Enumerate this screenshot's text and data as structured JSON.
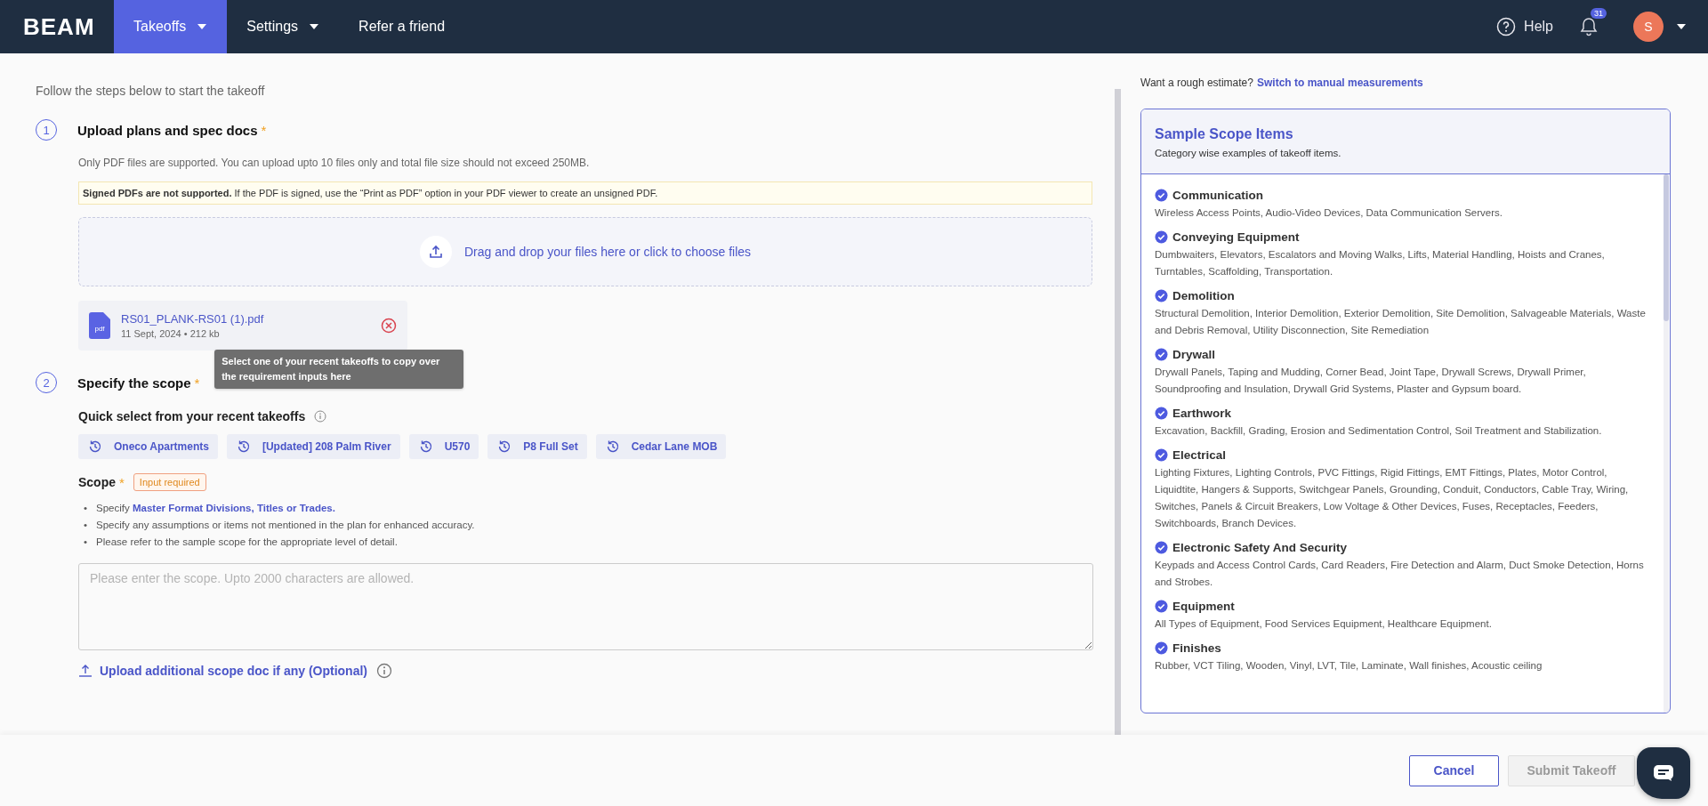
{
  "nav": {
    "logo": "BEAM",
    "items": [
      {
        "label": "Takeoffs",
        "selected": true,
        "dropdown": true
      },
      {
        "label": "Settings",
        "selected": false,
        "dropdown": true
      },
      {
        "label": "Refer a friend",
        "selected": false,
        "dropdown": false
      }
    ],
    "help": "Help",
    "notifications": "31",
    "avatar": "S"
  },
  "intro": "Follow the steps below to start the takeoff",
  "upload": {
    "number": "1",
    "title": "Upload plans and spec docs",
    "required_mark": "*",
    "note": "Only PDF files are supported. You can upload upto 10 files only and total file size should not exceed 250MB.",
    "warning": "**Signed PDFs are not supported.** If the PDF is signed, use the “Print as PDF” option in your PDF viewer to create an unsigned PDF.",
    "dropzone": "Drag and drop your files here or click to choose files",
    "files": [
      {
        "type": "pdf",
        "name": "RS01_PLANK-RS01 (1).pdf",
        "meta": "11 Sept, 2024 • 212 kb"
      }
    ]
  },
  "scope": {
    "number": "2",
    "title": "Specify the scope",
    "quick_select": "Quick select from your recent takeoffs",
    "tooltip": "Select one of your recent takeoffs to copy over the requirement inputs here",
    "recent": [
      "Oneco Apartments",
      "[Updated] 208 Palm River",
      "U570",
      "P8 Full Set",
      "Cedar Lane MOB"
    ],
    "label": "Scope",
    "required_mark": "*",
    "badge": "Input required",
    "bullets": [
      {
        "marker": "•",
        "text": "Specify ",
        "link": "Master Format Divisions, Titles or Trades."
      },
      {
        "marker": "•",
        "text": "Specify any assumptions or items not mentioned in the plan for enhanced accuracy."
      },
      {
        "marker": "•",
        "text": "Please refer to the sample scope for the appropriate level of detail."
      }
    ],
    "placeholder": "Please enter the scope. Upto 2000 characters are allowed.",
    "upload_link": "Upload additional scope doc if any (Optional)"
  },
  "estimate": {
    "prompt": "Want a rough estimate?",
    "link": "Switch to manual measurements"
  },
  "sample": {
    "title": "Sample Scope Items",
    "subtitle": "Category wise examples of takeoff items.",
    "items": [
      {
        "title": "Communication",
        "text": "Wireless Access Points, Audio-Video Devices, Data Communication Servers."
      },
      {
        "title": "Conveying Equipment",
        "text": "Dumbwaiters, Elevators, Escalators and Moving Walks, Lifts, Material Handling, Hoists and Cranes, Turntables, Scaffolding, Transportation."
      },
      {
        "title": "Demolition",
        "text": "Structural Demolition, Interior Demolition, Exterior Demolition, Site Demolition, Salvageable Materials, Waste and Debris Removal, Utility Disconnection, Site Remediation"
      },
      {
        "title": "Drywall",
        "text": "Drywall Panels, Taping and Mudding, Corner Bead, Joint Tape, Drywall Screws, Drywall Primer, Soundproofing and Insulation, Drywall Grid Systems, Plaster and Gypsum board."
      },
      {
        "title": "Earthwork",
        "text": "Excavation, Backfill, Grading, Erosion and Sedimentation Control, Soil Treatment and Stabilization."
      },
      {
        "title": "Electrical",
        "text": "Lighting Fixtures, Lighting Controls, PVC Fittings, Rigid Fittings, EMT Fittings, Plates, Motor Control, Liquidtite, Hangers & Supports, Switchgear Panels, Grounding, Conduit, Conductors, Cable Tray, Wiring, Switches, Panels & Circuit Breakers, Low Voltage & Other Devices, Fuses, Receptacles, Feeders, Switchboards, Branch Devices."
      },
      {
        "title": "Electronic Safety And Security",
        "text": "Keypads and Access Control Cards, Card Readers, Fire Detection and Alarm, Duct Smoke Detection, Horns and Strobes."
      },
      {
        "title": "Equipment",
        "text": "All Types of Equipment, Food Services Equipment, Healthcare Equipment."
      },
      {
        "title": "Finishes",
        "text": "Rubber, VCT Tiling, Wooden, Vinyl, LVT, Tile, Laminate, Wall finishes, Acoustic ceiling"
      }
    ]
  },
  "footer": {
    "cancel": "Cancel",
    "submit": {
      "label": "Submit Takeoff",
      "disabled": true
    }
  }
}
